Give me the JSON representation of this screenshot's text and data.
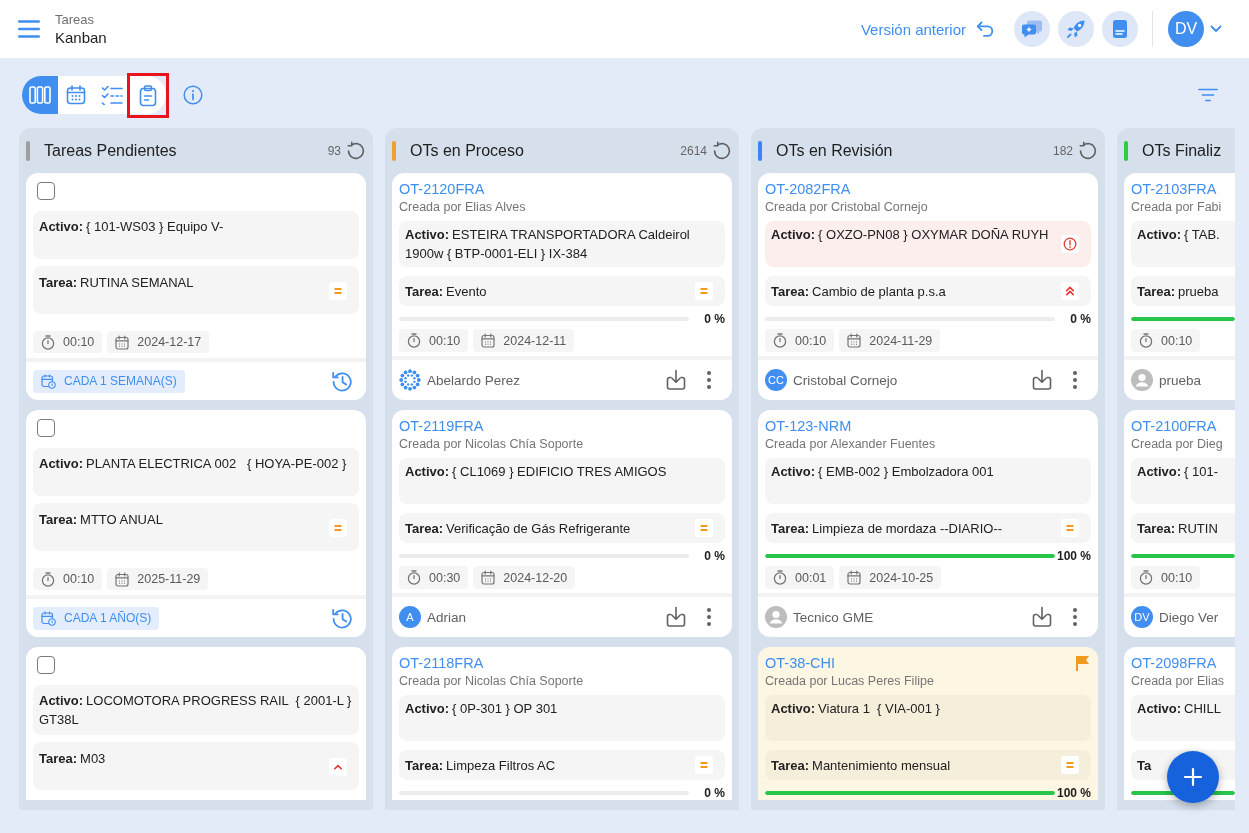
{
  "header": {
    "breadcrumb": "Tareas",
    "title": "Kanban",
    "previous_version": "Versión anterior",
    "user_initials": "DV"
  },
  "toolbar": {
    "views": [
      {
        "kind": "board",
        "selected": true,
        "highlighted": false
      },
      {
        "kind": "calendar",
        "selected": false,
        "highlighted": false
      },
      {
        "kind": "checklist",
        "selected": false,
        "highlighted": false
      },
      {
        "kind": "clipboard",
        "selected": false,
        "highlighted": true
      }
    ]
  },
  "columns": [
    {
      "title": "Tareas Pendientes",
      "count": "93",
      "color": "#9e9e9e",
      "cards": [
        {
          "kind": "task",
          "checked": false,
          "flagged": false,
          "asset": {
            "label": "Activo:",
            "value": "{ 101-WS03 } Equipo V-",
            "alert": false
          },
          "task": {
            "label": "Tarea:",
            "value": "RUTINA SEMANAL",
            "kind": "medium"
          },
          "time": "00:10",
          "date": "2024-12-17",
          "recurrence": "CADA 1 SEMANA(S)"
        },
        {
          "kind": "task",
          "checked": false,
          "flagged": false,
          "asset": {
            "label": "Activo:",
            "value": "PLANTA ELECTRICA 002   { HOYA-PE-002 }",
            "alert": false
          },
          "task": {
            "label": "Tarea:",
            "value": "MTTO ANUAL",
            "kind": "medium"
          },
          "time": "00:10",
          "date": "2025-11-29",
          "recurrence": "CADA 1 AÑO(S)"
        },
        {
          "kind": "task",
          "checked": false,
          "flagged": false,
          "asset": {
            "label": "Activo:",
            "value": "LOCOMOTORA PROGRESS RAIL  { 2001-L } GT38L",
            "alert": false
          },
          "task": {
            "label": "Tarea:",
            "value": "M03",
            "kind": "high"
          }
        }
      ]
    },
    {
      "title": "OTs en Proceso",
      "count": "2614",
      "color": "#f0a030",
      "cards": [
        {
          "kind": "order",
          "code": "OT-2120FRA",
          "created_by": "Creada por Elias Alves",
          "flagged": false,
          "asset": {
            "label": "Activo:",
            "value": "ESTEIRA TRANSPORTADORA Caldeirol  1900w { BTP-0001-ELI } IX-384",
            "alert": false
          },
          "task": {
            "label": "Tarea:",
            "value": "Evento",
            "kind": "medium"
          },
          "level": 0,
          "reading": "0 %",
          "time": "00:10",
          "date": "2024-12-11",
          "assignee": {
            "kind": "logo",
            "name": "Abelardo Perez"
          }
        },
        {
          "kind": "order",
          "code": "OT-2119FRA",
          "created_by": "Creada por Nicolas Chía Soporte",
          "flagged": false,
          "asset": {
            "label": "Activo:",
            "value": "{ CL1069 } EDIFICIO TRES AMIGOS",
            "alert": false
          },
          "task": {
            "label": "Tarea:",
            "value": "Verificação de Gás Refrigerante",
            "kind": "medium"
          },
          "level": 0,
          "reading": "0 %",
          "time": "00:30",
          "date": "2024-12-20",
          "assignee": {
            "kind": "initials",
            "initials": "A",
            "name": "Adrian"
          }
        },
        {
          "kind": "order",
          "code": "OT-2118FRA",
          "created_by": "Creada por Nicolas Chía Soporte",
          "flagged": false,
          "asset": {
            "label": "Activo:",
            "value": "{ 0P-301 } OP 301",
            "alert": false
          },
          "task": {
            "label": "Tarea:",
            "value": "Limpeza Filtros AC",
            "kind": "medium"
          },
          "level": 0,
          "reading": "0 %"
        }
      ]
    },
    {
      "title": "OTs en Revisión",
      "count": "182",
      "color": "#3b82f6",
      "cards": [
        {
          "kind": "order",
          "code": "OT-2082FRA",
          "created_by": "Creada por Cristobal Cornejo",
          "flagged": false,
          "asset": {
            "label": "Activo:",
            "value": "{ OXZO-PN08 } OXYMAR DOÑA RUYH",
            "alert": true
          },
          "task": {
            "label": "Tarea:",
            "value": "Cambio de planta p.s.a",
            "kind": "urgent"
          },
          "level": 0,
          "reading": "0 %",
          "time": "00:10",
          "date": "2024-11-29",
          "assignee": {
            "kind": "initials",
            "initials": "CC",
            "name": "Cristobal Cornejo"
          }
        },
        {
          "kind": "order",
          "code": "OT-123-NRM",
          "created_by": "Creada por Alexander Fuentes",
          "flagged": false,
          "asset": {
            "label": "Activo:",
            "value": "{ EMB-002 } Embolzadora 001",
            "alert": false
          },
          "task": {
            "label": "Tarea:",
            "value": "Limpieza de mordaza --DIARIO--",
            "kind": "medium"
          },
          "level": 1,
          "reading": "100 %",
          "time": "00:01",
          "date": "2024-10-25",
          "assignee": {
            "kind": "silhouette",
            "name": "Tecnico GME"
          }
        },
        {
          "kind": "order",
          "code": "OT-38-CHI",
          "created_by": "Creada por Lucas Peres Filipe",
          "flagged": true,
          "asset": {
            "label": "Activo:",
            "value": "Viatura 1  { VIA-001 }",
            "alert": false
          },
          "task": {
            "label": "Tarea:",
            "value": "Mantenimiento mensual",
            "kind": "medium"
          },
          "level": 1,
          "reading": "100 %"
        }
      ]
    },
    {
      "title": "OTs Finaliz",
      "color": "#2ecc40",
      "cards": [
        {
          "kind": "order",
          "code": "OT-2103FRA",
          "created_by": "Creada por Fabi",
          "flagged": false,
          "asset": {
            "label": "Activo:",
            "value": "{ TAB.",
            "alert": false
          },
          "task": {
            "label": "Tarea:",
            "value": "prueba"
          },
          "level": 1,
          "time": "00:10",
          "assignee": {
            "kind": "silhouette",
            "name": "prueba"
          }
        },
        {
          "kind": "order",
          "code": "OT-2100FRA",
          "created_by": "Creada por Dieg",
          "flagged": false,
          "asset": {
            "label": "Activo:",
            "value": "{ 101-",
            "alert": false
          },
          "task": {
            "label": "Tarea:",
            "value": "RUTIN"
          },
          "level": 1,
          "time": "00:10",
          "assignee": {
            "kind": "initials",
            "initials": "DV",
            "name": "Diego Ver"
          }
        },
        {
          "kind": "order",
          "code": "OT-2098FRA",
          "created_by": "Creada por Elias",
          "flagged": false,
          "asset": {
            "label": "Activo:",
            "value": "CHILL",
            "alert": false
          },
          "task": {
            "label": "Ta"
          },
          "level": 1
        }
      ]
    }
  ]
}
